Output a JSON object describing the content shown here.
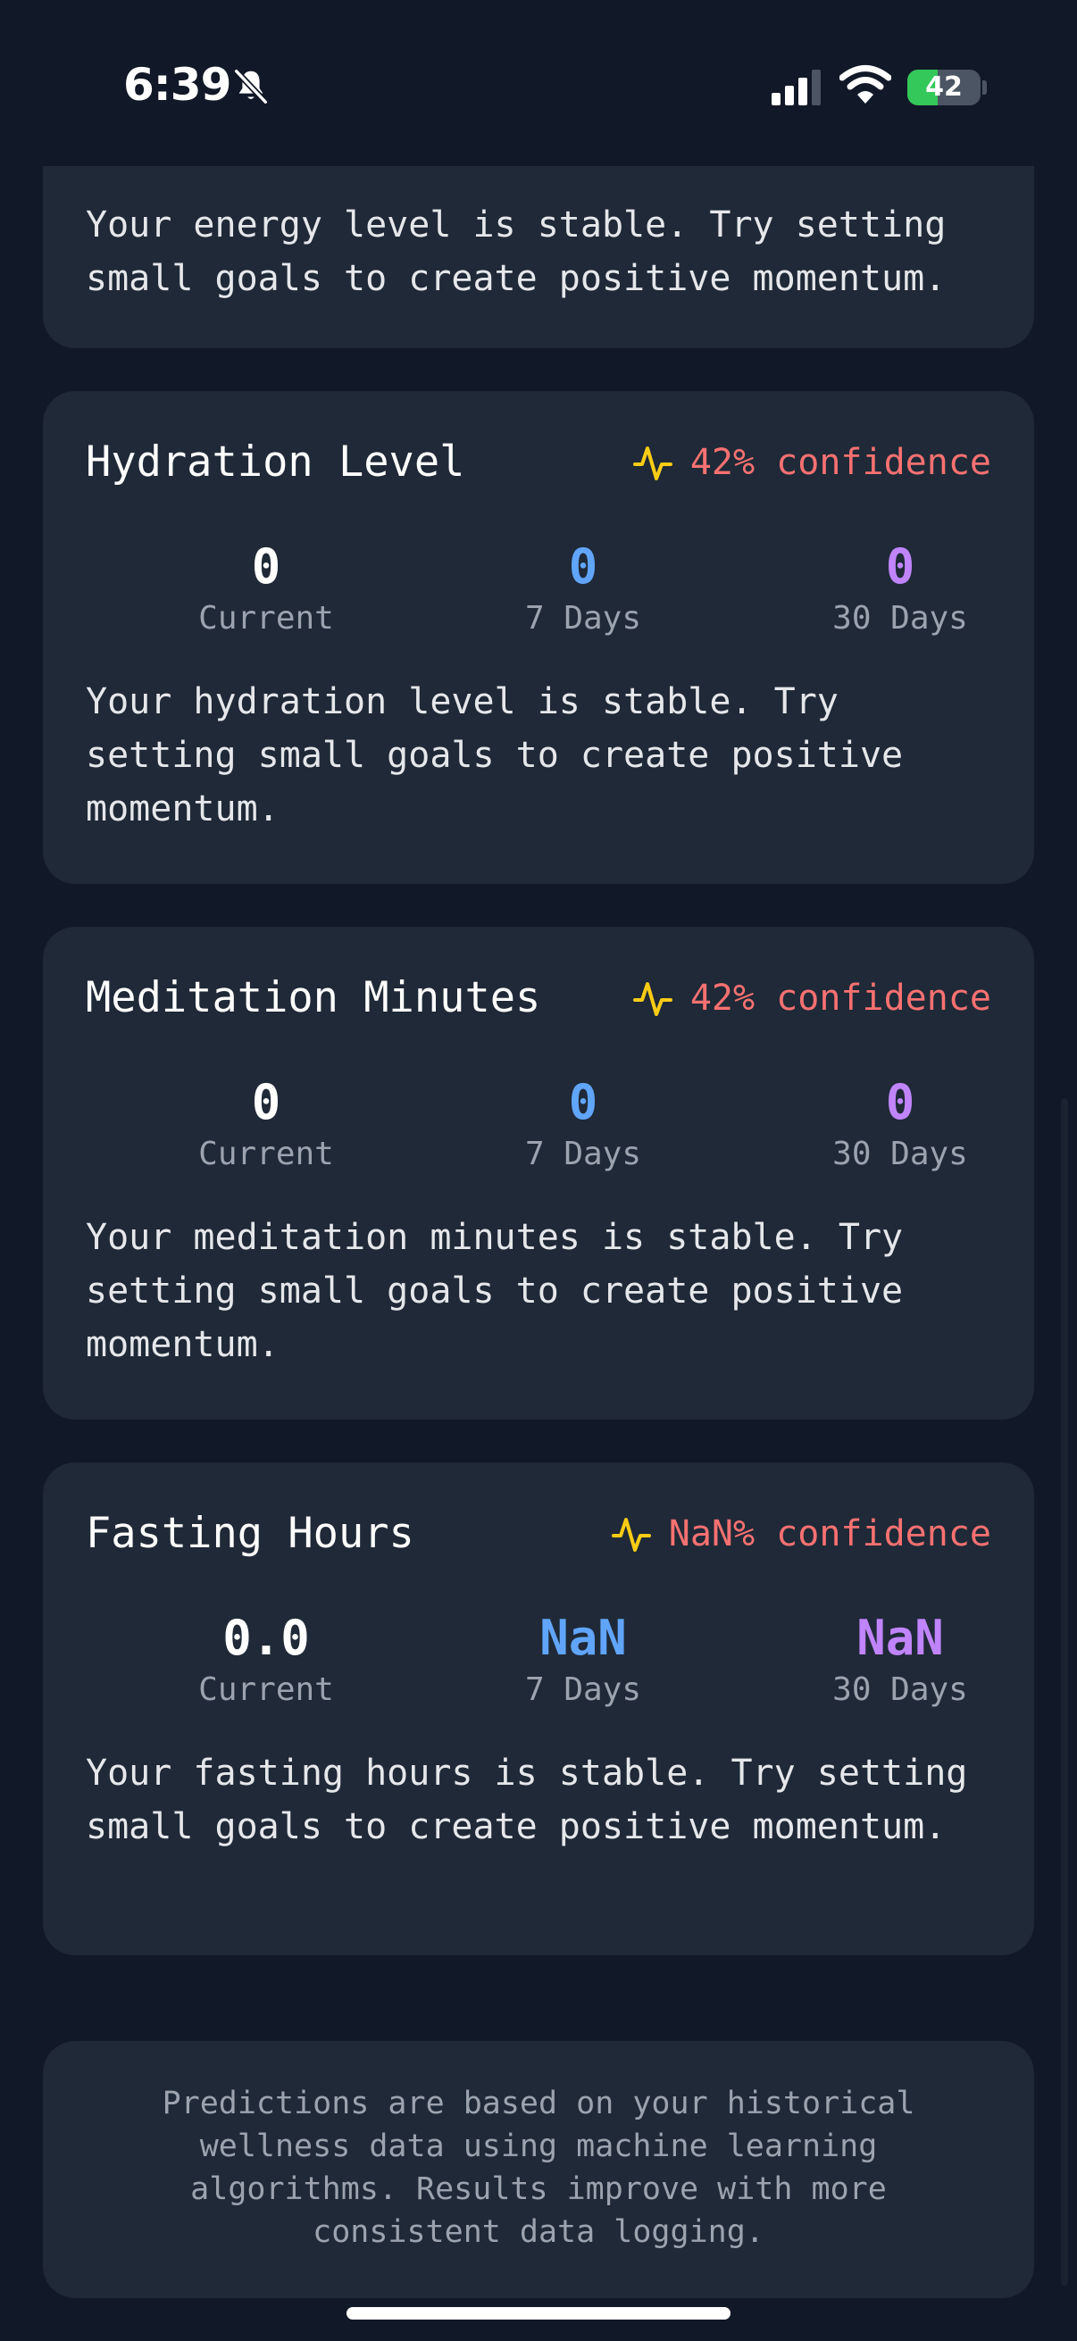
{
  "status_bar": {
    "time": "6:39",
    "battery_level": 42,
    "battery_text": "42"
  },
  "cards": {
    "energy": {
      "description": "Your energy level is stable. Try setting small goals to create positive momentum."
    },
    "hydration": {
      "title": "Hydration Level",
      "confidence": "42% confidence",
      "current_value": "0",
      "current_label": "Current",
      "week_value": "0",
      "week_label": "7 Days",
      "month_value": "0",
      "month_label": "30 Days",
      "description": "Your hydration level is stable. Try setting small goals to create positive momentum."
    },
    "meditation": {
      "title": "Meditation Minutes",
      "confidence": "42% confidence",
      "current_value": "0",
      "current_label": "Current",
      "week_value": "0",
      "week_label": "7 Days",
      "month_value": "0",
      "month_label": "30 Days",
      "description": "Your meditation minutes is stable. Try setting small goals to create positive momentum."
    },
    "fasting": {
      "title": "Fasting Hours",
      "confidence": "NaN% confidence",
      "current_value": "0.0",
      "current_label": "Current",
      "week_value": "NaN",
      "week_label": "7 Days",
      "month_value": "NaN",
      "month_label": "30 Days",
      "description": "Your fasting hours is stable. Try setting small goals to create positive momentum."
    }
  },
  "footer": {
    "note": "Predictions are based on your historical wellness data using machine learning algorithms. Results improve with more consistent data logging."
  },
  "colors": {
    "background": "#111827",
    "card": "#1f2937",
    "confidence": "#f87171",
    "pulse_icon": "#facc15",
    "week_value": "#60a5fa",
    "month_value": "#c084fc",
    "battery": "#34c759"
  },
  "icons": {
    "silent": "bell-slash-icon",
    "signal": "cellular-signal-icon",
    "wifi": "wifi-icon",
    "battery": "battery-icon",
    "confidence": "pulse-icon"
  }
}
